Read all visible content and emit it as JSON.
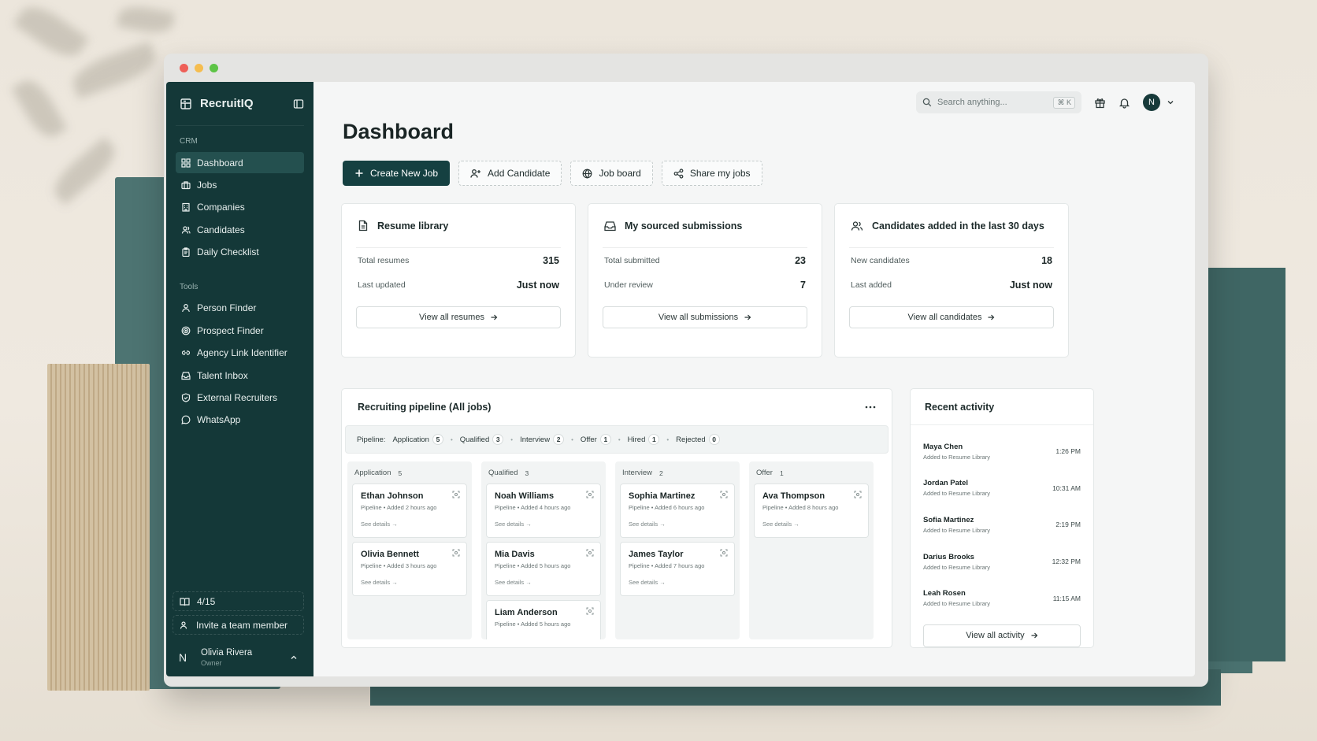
{
  "window": {
    "controls": {
      "close_color": "#ee5f57",
      "minimize_color": "#f5bd4f",
      "maximize_color": "#5dc446"
    }
  },
  "brand": {
    "name": "RecruitIQ",
    "accent": "#143838"
  },
  "sidebar": {
    "crm_label": "CRM",
    "crm_items": [
      {
        "label": "Dashboard",
        "icon": "grid-icon",
        "active": true
      },
      {
        "label": "Jobs",
        "icon": "briefcase-icon"
      },
      {
        "label": "Companies",
        "icon": "building-icon"
      },
      {
        "label": "Candidates",
        "icon": "users-icon"
      },
      {
        "label": "Daily Checklist",
        "icon": "clipboard-icon"
      }
    ],
    "tools_label": "Tools",
    "tools_items": [
      {
        "label": "Person Finder",
        "icon": "person-icon"
      },
      {
        "label": "Prospect Finder",
        "icon": "target-icon"
      },
      {
        "label": "Agency Link Identifier",
        "icon": "link-icon"
      },
      {
        "label": "Talent Inbox",
        "icon": "inbox-icon"
      },
      {
        "label": "External Recruiters",
        "icon": "badge-icon"
      },
      {
        "label": "WhatsApp",
        "icon": "chat-icon"
      }
    ],
    "progress_label": "4/15",
    "invite_label": "Invite a team member",
    "user": {
      "initial": "N",
      "name": "Olivia Rivera",
      "role": "Owner"
    }
  },
  "topbar": {
    "search_placeholder": "Search anything...",
    "shortcut": "⌘ K",
    "avatar_initial": "N"
  },
  "page": {
    "title": "Dashboard"
  },
  "actions": {
    "create_job": "Create New Job",
    "add_candidate": "Add Candidate",
    "job_board": "Job board",
    "share_jobs": "Share my jobs"
  },
  "stats": {
    "resume": {
      "title": "Resume library",
      "rows": [
        {
          "label": "Total resumes",
          "value": "315"
        },
        {
          "label": "Last updated",
          "value": "Just now"
        }
      ],
      "link": "View all resumes"
    },
    "submissions": {
      "title": "My sourced submissions",
      "rows": [
        {
          "label": "Total submitted",
          "value": "23"
        },
        {
          "label": "Under review",
          "value": "7"
        }
      ],
      "link": "View all submissions"
    },
    "candidates": {
      "title": "Candidates added in the last 30 days",
      "rows": [
        {
          "label": "New candidates",
          "value": "18"
        },
        {
          "label": "Last added",
          "value": "Just now"
        }
      ],
      "link": "View all candidates"
    }
  },
  "pipeline": {
    "title": "Recruiting pipeline (All jobs)",
    "strip_label": "Pipeline:",
    "stages": [
      {
        "label": "Application",
        "count": "5"
      },
      {
        "label": "Qualified",
        "count": "3"
      },
      {
        "label": "Interview",
        "count": "2"
      },
      {
        "label": "Offer",
        "count": "1"
      },
      {
        "label": "Hired",
        "count": "1"
      },
      {
        "label": "Rejected",
        "count": "0"
      }
    ],
    "columns": [
      {
        "title": "Application",
        "count": "5",
        "cards": [
          {
            "name": "Ethan Johnson",
            "meta": "Pipeline • Added 2 hours ago",
            "link": "See details"
          },
          {
            "name": "Olivia Bennett",
            "meta": "Pipeline • Added 3 hours ago",
            "link": "See details"
          }
        ]
      },
      {
        "title": "Qualified",
        "count": "3",
        "cards": [
          {
            "name": "Noah Williams",
            "meta": "Pipeline • Added 4 hours ago",
            "link": "See details"
          },
          {
            "name": "Mia Davis",
            "meta": "Pipeline • Added 5 hours ago",
            "link": "See details"
          },
          {
            "name": "Liam Anderson",
            "meta": "Pipeline • Added 5 hours ago",
            "link": ""
          }
        ]
      },
      {
        "title": "Interview",
        "count": "2",
        "cards": [
          {
            "name": "Sophia Martinez",
            "meta": "Pipeline • Added 6 hours ago",
            "link": "See details"
          },
          {
            "name": "James Taylor",
            "meta": "Pipeline • Added 7 hours ago",
            "link": "See details"
          }
        ]
      },
      {
        "title": "Offer",
        "count": "1",
        "cards": [
          {
            "name": "Ava Thompson",
            "meta": "Pipeline • Added 8 hours ago",
            "link": "See details"
          }
        ]
      }
    ]
  },
  "activity": {
    "title": "Recent activity",
    "items": [
      {
        "name": "Maya Chen",
        "desc": "Added to Resume Library",
        "time": "1:26 PM"
      },
      {
        "name": "Jordan Patel",
        "desc": "Added to Resume Library",
        "time": "10:31 AM"
      },
      {
        "name": "Sofia Martinez",
        "desc": "Added to Resume Library",
        "time": "2:19 PM"
      },
      {
        "name": "Darius Brooks",
        "desc": "Added to Resume Library",
        "time": "12:32 PM"
      },
      {
        "name": "Leah Rosen",
        "desc": "Added to Resume Library",
        "time": "11:15 AM"
      }
    ],
    "link": "View all activity"
  }
}
